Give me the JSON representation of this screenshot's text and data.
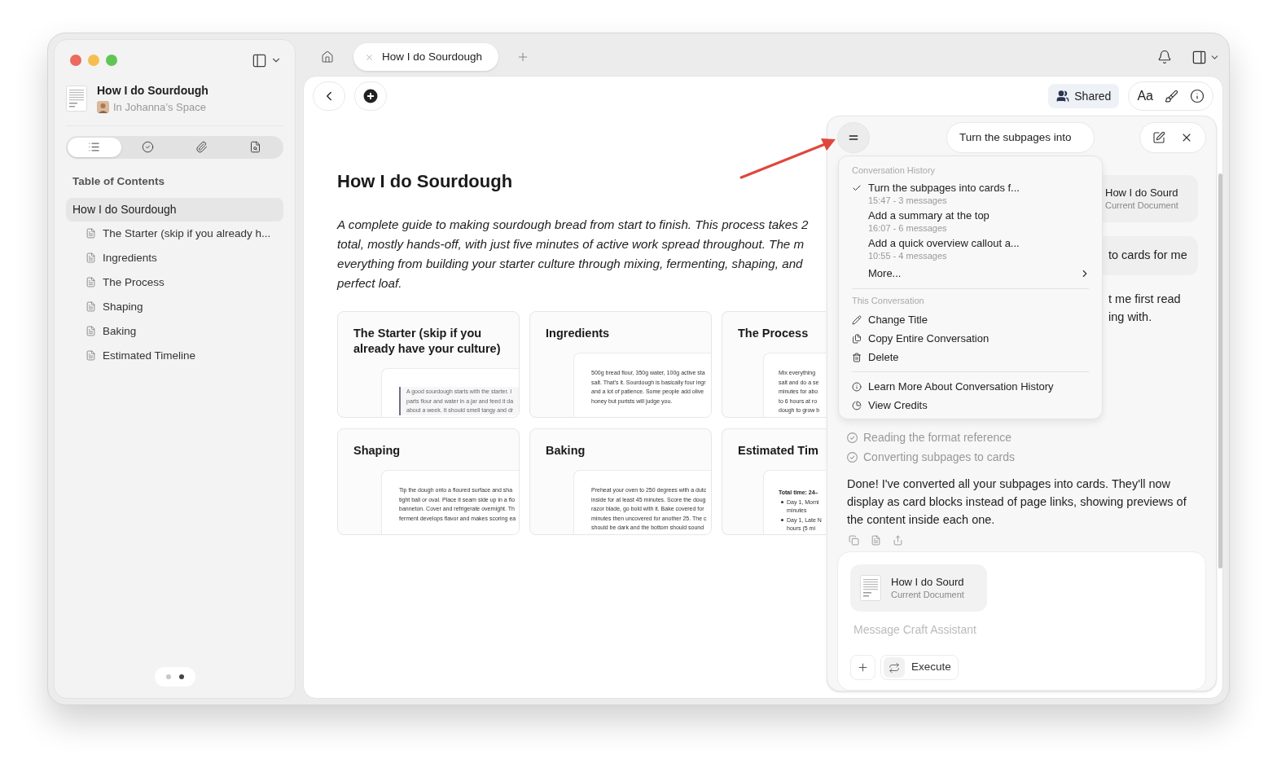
{
  "sidebar": {
    "document": {
      "title": "How I do Sourdough",
      "space": "In Johanna’s Space"
    },
    "view_tabs": [
      {
        "kind": "list",
        "selected": true
      },
      {
        "kind": "tasks",
        "selected": false
      },
      {
        "kind": "attachments",
        "selected": false
      },
      {
        "kind": "search",
        "selected": false
      }
    ],
    "toc": {
      "heading": "Table of Contents",
      "items": [
        {
          "label": "How I do Sourdough",
          "selected": true,
          "children": [
            {
              "label": "The Starter (skip if you already h...",
              "selected": false
            },
            {
              "label": "Ingredients",
              "selected": false
            },
            {
              "label": "The Process",
              "selected": false
            },
            {
              "label": "Shaping",
              "selected": false
            },
            {
              "label": "Baking",
              "selected": false
            },
            {
              "label": "Estimated Timeline",
              "selected": false
            }
          ]
        }
      ]
    },
    "pager": [
      {
        "selected": false
      },
      {
        "selected": true
      }
    ]
  },
  "tab_bar": {
    "tabs": [
      {
        "label": "How I do Sourdough",
        "selected": true
      }
    ]
  },
  "toolbar": {
    "shared_label": "Shared",
    "font_label": "Aa"
  },
  "document": {
    "title": "How I do Sourdough",
    "intro_lines": [
      "A complete guide to making sourdough bread from start to finish. This process takes 2",
      "total, mostly hands-off, with just five minutes of active work spread throughout. The m",
      "everything from building your starter culture through mixing, fermenting, shaping, and",
      "perfect loaf."
    ],
    "cards": [
      {
        "title": "The Starter (skip if you already have your culture)",
        "preview": {
          "kind": "quote",
          "lines": [
            "A good sourdough starts with the starter. I",
            "parts flour and water in a jar and feed it da",
            "about a week. It should smell tangy and dr"
          ]
        }
      },
      {
        "title": "Ingredients",
        "preview": {
          "kind": "text",
          "lines": [
            "500g bread flour, 350g water, 100g active sta",
            "salt. That's it. Sourdough is basically four ingr",
            "and a lot of patience. Some people add olive",
            "honey but purists will judge you."
          ]
        }
      },
      {
        "title": "The Process",
        "preview": {
          "kind": "text",
          "lines": [
            "Mix everything",
            "salt and do a se",
            "minutes for abo",
            "to 6 hours at ro",
            "dough to grow b"
          ]
        }
      },
      {
        "title": "Shaping",
        "preview": {
          "kind": "text",
          "lines": [
            "Tip the dough onto a floured surface and sha",
            "tight ball or oval. Place it seam side up in a flo",
            "banneton. Cover and refrigerate overnight. Th",
            "ferment develops flavor and makes scoring ea"
          ]
        }
      },
      {
        "title": "Baking",
        "preview": {
          "kind": "text",
          "lines": [
            "Preheat your oven to 250 degrees with a dutc",
            "inside for at least 45 minutes. Score the doug",
            "razor blade, go bold with it. Bake covered for",
            "minutes then uncovered for another 25. The c",
            "should be dark and the bottom should sound"
          ]
        }
      },
      {
        "title": "Estimated Tim",
        "preview": {
          "kind": "list",
          "heading": "Total time: 24–",
          "items": [
            [
              "Day 1, Morni",
              "minutes"
            ],
            [
              "Day 1, Late N",
              "hours (5 mi"
            ]
          ]
        }
      }
    ]
  },
  "assistant": {
    "title": "Turn the subpages into",
    "menu_open": true,
    "behind": {
      "chip": {
        "title": "How I do Sourd",
        "subtitle": "Current Document"
      },
      "user_fragment": "to cards for me",
      "reply_lines": [
        "t me first read",
        "ing with."
      ]
    },
    "steps": [
      {
        "label": "Reading the format reference",
        "done": true
      },
      {
        "label": "Converting subpages to cards",
        "done": true
      }
    ],
    "reply": "Done! I've converted all your subpages into cards. They'll now display as card blocks instead of page links, showing previews of the content inside each one.",
    "composer": {
      "chip": {
        "title": "How I do Sourd",
        "subtitle": "Current Document"
      },
      "placeholder": "Message Craft Assistant",
      "execute_label": "Execute"
    }
  },
  "menu": {
    "sections": [
      {
        "heading": "Conversation History",
        "items": [
          {
            "kind": "history",
            "title": "Turn the subpages into cards f...",
            "meta": "15:47 - 3 messages",
            "selected": true
          },
          {
            "kind": "history",
            "title": "Add a summary at the top",
            "meta": "16:07 - 6 messages",
            "selected": false
          },
          {
            "kind": "history",
            "title": "Add a quick overview callout a...",
            "meta": "10:55 - 4 messages",
            "selected": false
          },
          {
            "kind": "more",
            "label": "More..."
          }
        ]
      },
      {
        "heading": "This Conversation",
        "items": [
          {
            "kind": "rename",
            "label": "Change Title"
          },
          {
            "kind": "copy",
            "label": "Copy Entire Conversation"
          },
          {
            "kind": "delete",
            "label": "Delete"
          }
        ]
      },
      {
        "items": [
          {
            "kind": "info",
            "label": "Learn More About Conversation History"
          },
          {
            "kind": "credits",
            "label": "View Credits"
          }
        ]
      }
    ]
  }
}
